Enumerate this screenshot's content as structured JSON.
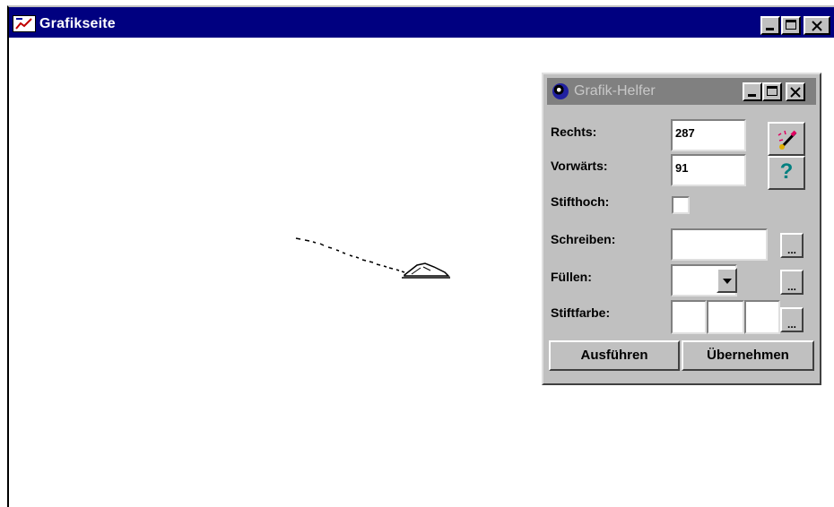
{
  "window": {
    "title": "Grafikseite",
    "controls": {
      "minimize": "_",
      "maximize": "□",
      "close": "×"
    }
  },
  "helper": {
    "title": "Grafik-Helfer",
    "controls": {
      "minimize": "_",
      "maximize": "□",
      "close": "×"
    },
    "fields": {
      "rechts_label": "Rechts:",
      "rechts_value": "287",
      "vorwaerts_label": "Vorwärts:",
      "vorwaerts_value": "91",
      "stifthoch_label": "Stifthoch:",
      "schreiben_label": "Schreiben:",
      "schreiben_value": "",
      "fuellen_label": "Füllen:",
      "fuellen_value": "",
      "stiftfarbe_label": "Stiftfarbe:"
    },
    "ellipsis": "...",
    "help_glyph": "?",
    "buttons": {
      "ausfuehren": "Ausführen",
      "uebernehmen": "Übernehmen"
    }
  },
  "icons": {
    "app": "graphics-page-icon",
    "helper": "globe-icon",
    "pen": "pen-icon",
    "help": "help-icon",
    "turtle": "turtle-icon"
  },
  "colors": {
    "titlebar_active": "#000080",
    "titlebar_inactive": "#808080",
    "face": "#c0c0c0",
    "help_glyph": "#008080"
  }
}
